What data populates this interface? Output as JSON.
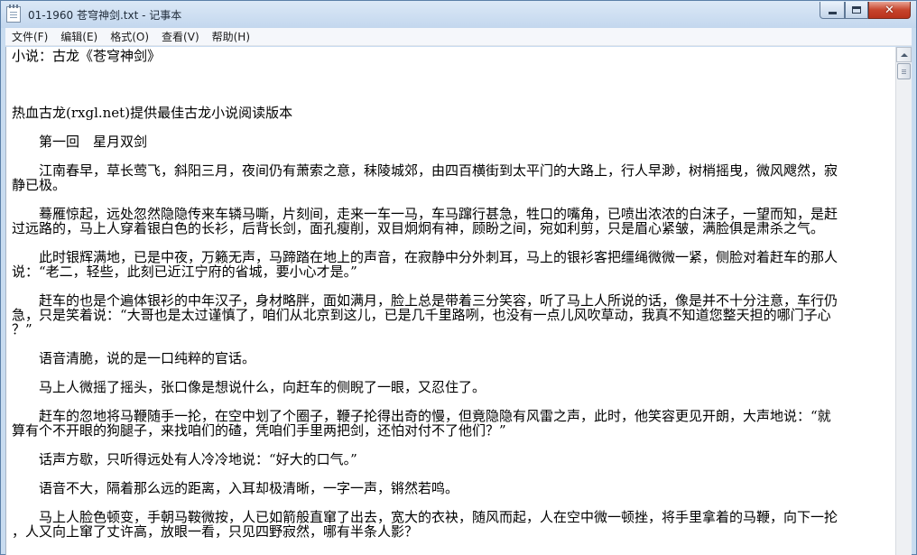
{
  "window": {
    "title": "01-1960 苍穹神剑.txt - 记事本"
  },
  "menu": [
    {
      "label": "文件(F)"
    },
    {
      "label": "编辑(E)"
    },
    {
      "label": "格式(O)"
    },
    {
      "label": "查看(V)"
    },
    {
      "label": "帮助(H)"
    }
  ],
  "editor": {
    "lines": [
      "小说：古龙《苍穹神剑》",
      "",
      "",
      "热血古龙(rxgl.net)提供最佳古龙小说阅读版本",
      "　　第一回　星月双剑",
      "　　江南春早，草长莺飞，斜阳三月，夜间仍有萧索之意，秣陵城郊，由四百横街到太平门的大路上，行人早渺，树梢摇曳，微风飕然，寂",
      "静已极。",
      "　　蓦雁惊起，远处忽然隐隐传来车辚马嘶，片刻间，走来一车一马，车马蹿行甚急，牲口的嘴角，已喷出浓浓的白沫子，一望而知，是赶",
      "过远路的，马上人穿着银白色的长衫，后背长剑，面孔瘦削，双目炯炯有神，顾盼之间，宛如利剪，只是眉心紧皱，满脸俱是肃杀之气。",
      "　　此时银辉满地，已是中夜，万籁无声，马蹄踏在地上的声音，在寂静中分外刺耳，马上的银衫客把缰绳微微一紧，侧脸对着赶车的那人",
      "说：“老二，轻些，此刻已近江宁府的省城，要小心才是。”",
      "　　赶车的也是个遍体银衫的中年汉子，身材略胖，面如满月，脸上总是带着三分笑容，听了马上人所说的话，像是并不十分注意，车行仍",
      "急，只是笑着说：“大哥也是太过谨慎了，咱们从北京到这儿，已是几千里路咧，也没有一点儿风吹草动，我真不知道您整天担的哪门子心",
      "？”",
      "　　语音清脆，说的是一口纯粹的官话。",
      "　　马上人微摇了摇头，张口像是想说什么，向赶车的侧睨了一眼，又忍住了。",
      "　　赶车的忽地将马鞭随手一抡，在空中划了个圈子，鞭子抡得出奇的慢，但竟隐隐有风雷之声，此时，他笑容更见开朗，大声地说：“就",
      "算有个不开眼的狗腿子，来找咱们的碴，凭咱们手里两把剑，还怕对付不了他们？”",
      "　　话声方歇，只听得远处有人冷冷地说：“好大的口气。”",
      "　　语音不大，隔着那么远的距离，入耳却极清晰，一字一声，锵然若鸣。",
      "　　马上人脸色顿变，手朝马鞍微按，人已如箭般直窜了出去，宽大的衣袂，随风而起，人在空中微一顿挫，将手里拿着的马鞭，向下一抡",
      "，人又向上窜了丈许高，放眼一看，只见四野寂然，哪有半条人影？"
    ]
  },
  "scrollbar": {
    "position": 0.0
  }
}
